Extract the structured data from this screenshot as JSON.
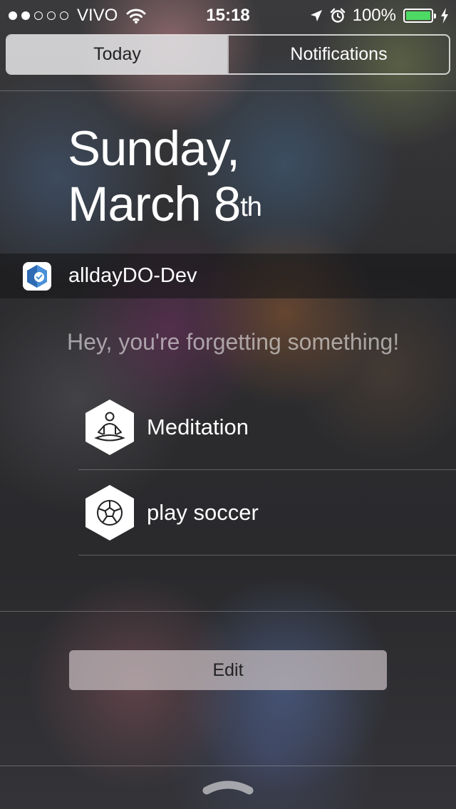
{
  "status_bar": {
    "carrier": "VIVO",
    "time": "15:18",
    "battery": "100%",
    "signal_bars_filled": 2,
    "signal_bars_total": 5,
    "battery_level": 1.0,
    "battery_color": "#4cd964",
    "icons": [
      "wifi-icon",
      "location-arrow-icon",
      "alarm-clock-icon",
      "charging-bolt-icon"
    ]
  },
  "tabs": [
    {
      "label": "Today",
      "selected": true
    },
    {
      "label": "Notifications",
      "selected": false
    }
  ],
  "date": {
    "weekday": "Sunday,",
    "month_day": "March 8",
    "ordinal_suffix": "th"
  },
  "widget": {
    "app_name": "alldayDO-Dev",
    "app_icon": "allday-hexagon-check-icon",
    "message": "Hey, you're forgetting something!",
    "tasks": [
      {
        "label": "Meditation",
        "icon": "meditation-icon"
      },
      {
        "label": "play soccer",
        "icon": "soccer-ball-icon"
      }
    ]
  },
  "edit_label": "Edit",
  "colors": {
    "accent_blue": "#4a90d9",
    "segment_active_bg": "#e1e1e4"
  }
}
